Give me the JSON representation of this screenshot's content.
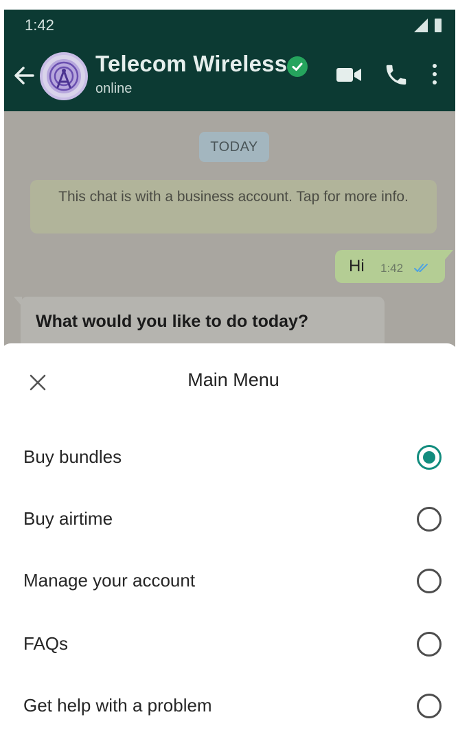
{
  "status_bar": {
    "time": "1:42"
  },
  "header": {
    "contact_name": "Telecom Wireless",
    "contact_status": "online",
    "verified": true
  },
  "chat": {
    "date_chip": "TODAY",
    "business_notice": "This chat is with a business account. Tap for more info.",
    "outgoing_message": {
      "text": "Hi",
      "time": "1:42"
    },
    "incoming_message": {
      "text": "What would you like to do today?"
    }
  },
  "sheet": {
    "title": "Main Menu",
    "options": [
      {
        "label": "Buy bundles",
        "selected": true
      },
      {
        "label": "Buy airtime",
        "selected": false
      },
      {
        "label": "Manage your account",
        "selected": false
      },
      {
        "label": "FAQs",
        "selected": false
      },
      {
        "label": "Get help with a problem",
        "selected": false
      }
    ]
  },
  "colors": {
    "header_bg": "#0c3a33",
    "accent": "#128c7e",
    "verified": "#25a45d",
    "outgoing_bubble": "#b4cd94"
  },
  "icons": [
    "back-arrow-icon",
    "verified-check-icon",
    "video-call-icon",
    "phone-call-icon",
    "more-options-icon",
    "double-check-icon",
    "close-icon",
    "radio-icon"
  ]
}
